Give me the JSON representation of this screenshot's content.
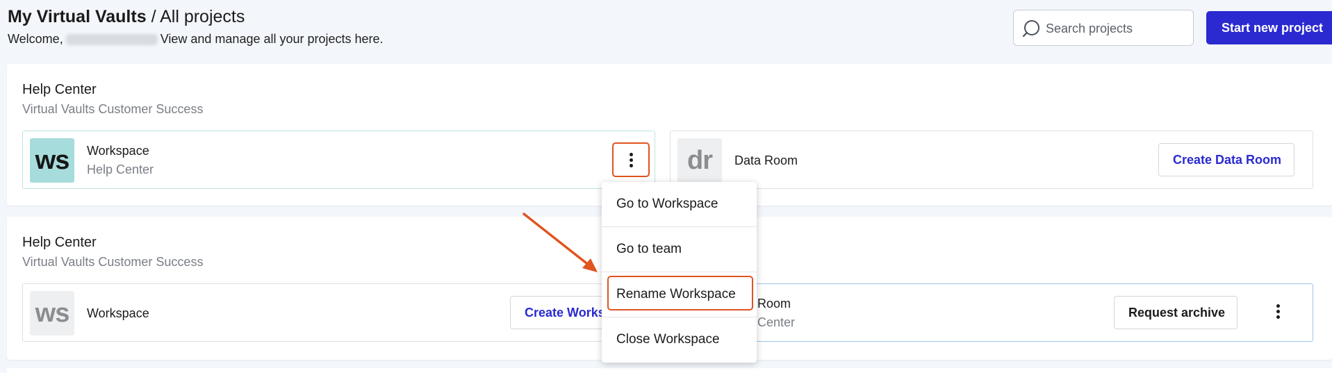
{
  "header": {
    "title_app": "My Virtual Vaults",
    "title_separator": "/",
    "title_section": "All projects",
    "welcome_prefix": "Welcome,",
    "welcome_suffix": "View and manage all your projects here."
  },
  "search": {
    "placeholder": "Search projects",
    "icon": "search-icon"
  },
  "start_button": {
    "label": "Start new project"
  },
  "colors": {
    "accent": "#2a2ad0",
    "highlight": "#e0541f",
    "workspace_logo_bg": "#a6dcdc"
  },
  "projects": [
    {
      "title": "Help Center",
      "subtitle": "Virtual Vaults Customer Success",
      "workspace": {
        "logo": "ws",
        "name": "Workspace",
        "sub": "Help Center"
      },
      "dataroom": {
        "logo": "dr",
        "name": "Data Room",
        "button": "Create Data Room"
      }
    },
    {
      "title": "Help Center",
      "subtitle": "Virtual Vaults Customer Success",
      "workspace": {
        "logo": "ws",
        "name": "Workspace",
        "button": "Create Works"
      },
      "dataroom": {
        "name_fragment": "a Room",
        "sub_fragment": "p Center",
        "button": "Request archive"
      }
    }
  ],
  "menu": {
    "items": [
      "Go to Workspace",
      "Go to team",
      "Rename Workspace",
      "Close Workspace"
    ]
  }
}
